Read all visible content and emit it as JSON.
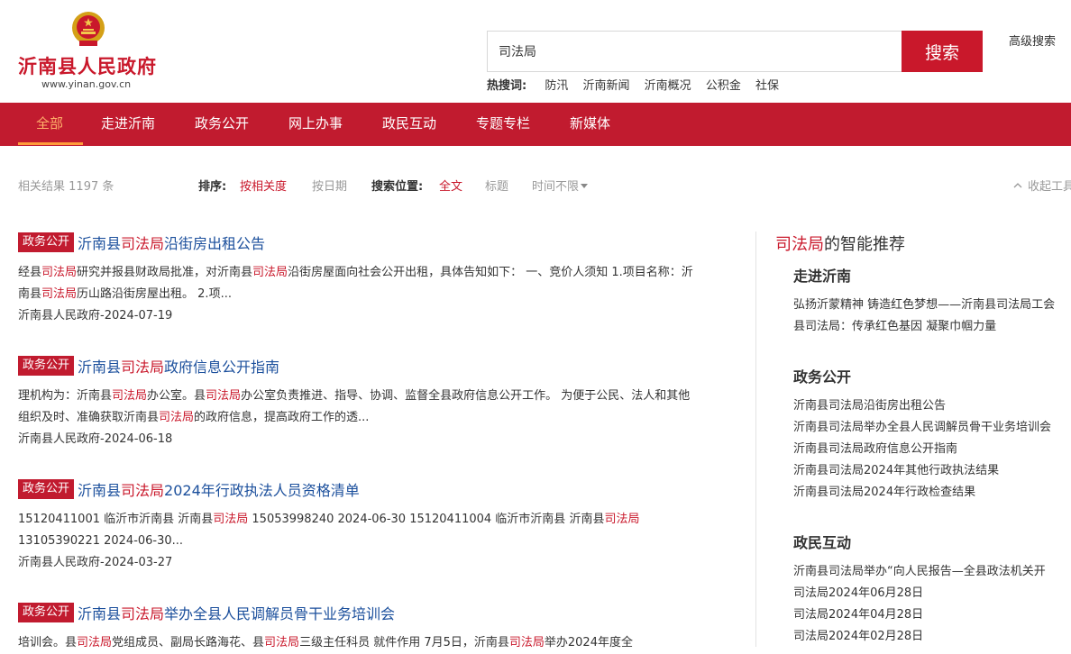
{
  "header": {
    "site_name": "沂南县人民政府",
    "site_url": "www.yinan.gov.cn",
    "search_value": "司法局",
    "search_button": "搜索",
    "advanced_search": "高级搜索",
    "hot_label": "热搜词:",
    "hot_words": [
      "防汛",
      "沂南新闻",
      "沂南概况",
      "公积金",
      "社保"
    ]
  },
  "nav": {
    "items": [
      "全部",
      "走进沂南",
      "政务公开",
      "网上办事",
      "政民互动",
      "专题专栏",
      "新媒体"
    ],
    "active_index": 0
  },
  "filter": {
    "count_prefix": "相关结果",
    "count": "1197",
    "count_suffix": "条",
    "sort_label": "排序:",
    "sort_relevance": "按相关度",
    "sort_date": "按日期",
    "position_label": "搜索位置:",
    "position_all": "全文",
    "position_title": "标题",
    "time": "时间不限",
    "collapse": "收起工具"
  },
  "results": [
    {
      "badge": "政务公开",
      "title_pre": "沂南县",
      "title_hl": "司法局",
      "title_post": "沿街房出租公告",
      "summary": "经县司法局研究并报县财政局批准，对沂南县司法局沿街房屋面向社会公开出租，具体告知如下： 一、竞价人须知 1.项目名称：沂南县司法局历山路沿街房屋出租。 2.项...",
      "meta": "沂南县人民政府-2024-07-19"
    },
    {
      "badge": "政务公开",
      "title_pre": "沂南县",
      "title_hl": "司法局",
      "title_post": "政府信息公开指南",
      "summary": "理机构为：沂南县司法局办公室。县司法局办公室负责推进、指导、协调、监督全县政府信息公开工作。 为便于公民、法人和其他组织及时、准确获取沂南县司法局的政府信息，提高政府工作的透...",
      "meta": "沂南县人民政府-2024-06-18"
    },
    {
      "badge": "政务公开",
      "title_pre": "沂南县",
      "title_hl": "司法局",
      "title_post": "2024年行政执法人员资格清单",
      "summary": "15120411001 临沂市沂南县 沂南县司法局 15053998240 2024-06-30 15120411004 临沂市沂南县 沂南县司法局 13105390221 2024-06-30...",
      "meta": "沂南县人民政府-2024-03-27"
    },
    {
      "badge": "政务公开",
      "title_pre": "沂南县",
      "title_hl": "司法局",
      "title_post": "举办全县人民调解员骨干业务培训会",
      "summary": "培训会。县司法局党组成员、副局长路海花、县司法局三级主任科员 就件作用 7月5日，沂南县司法局举办2024年度全",
      "meta": ""
    }
  ],
  "sidebar": {
    "rec_hl": "司法局",
    "rec_suffix": "的智能推荐",
    "sections": [
      {
        "head": "走进沂南",
        "links": [
          "弘扬沂蒙精神 铸造红色梦想——沂南县司法局工会",
          "县司法局：传承红色基因 凝聚巾帼力量"
        ]
      },
      {
        "head": "政务公开",
        "links": [
          "沂南县司法局沿街房出租公告",
          "沂南县司法局举办全县人民调解员骨干业务培训会",
          "沂南县司法局政府信息公开指南",
          "沂南县司法局2024年其他行政执法结果",
          "沂南县司法局2024年行政检查结果"
        ]
      },
      {
        "head": "政民互动",
        "links": [
          "沂南县司法局举办“向人民报告—全县政法机关开",
          "司法局2024年06月28日",
          "司法局2024年04月28日",
          "司法局2024年02月28日"
        ]
      }
    ]
  },
  "colors": {
    "brand_red": "#c11b2f",
    "highlight": "#c9182b",
    "link_blue": "#1b4f9c",
    "nav_active": "#ffb06a"
  },
  "icons": [
    "national-emblem-icon",
    "caret-down-icon",
    "chevron-up-icon"
  ]
}
